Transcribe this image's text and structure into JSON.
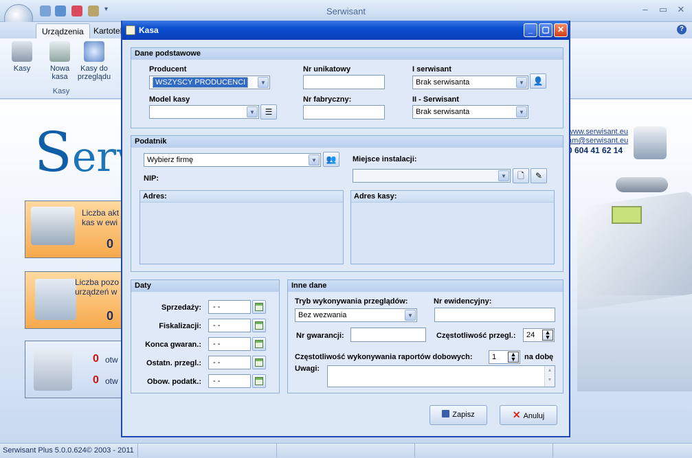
{
  "app": {
    "title": "Serwisant",
    "tabs": [
      "Urządzenia",
      "Kartotek"
    ],
    "ribbon_buttons": [
      {
        "label": "Kasy"
      },
      {
        "label": "Nowa kasa"
      },
      {
        "label": "Kasy do przeglądu"
      }
    ],
    "ribbon_group_label": "Kasy",
    "logo_text": "erw",
    "contact": {
      "website": "www.serwisant.eu",
      "email": "am@serwisant.eu",
      "phone": "0 604 41 62 14"
    },
    "cards": [
      {
        "text": "Liczba akt kas w ewi",
        "value": "0"
      },
      {
        "text": "Liczba pozo urządzeń w",
        "value": "0"
      },
      {
        "rows": [
          {
            "value": "0",
            "text": "otw"
          },
          {
            "value": "0",
            "text": "otw"
          }
        ]
      }
    ],
    "statusbar": "Serwisant Plus 5.0.0.624© 2003 - 2011"
  },
  "dialog": {
    "title": "Kasa",
    "dane_podstawowe": {
      "header": "Dane podstawowe",
      "producent_label": "Producent",
      "producent_value": "WSZYSCY PRODUCENCI",
      "nr_unikatowy_label": "Nr unikatowy",
      "nr_unikatowy_value": "",
      "serwisant1_label": "I serwisant",
      "serwisant1_value": "Brak serwisanta",
      "model_label": "Model kasy",
      "model_value": "",
      "nr_fabryczny_label": "Nr fabryczny:",
      "nr_fabryczny_value": "",
      "serwisant2_label": "II - Serwisant",
      "serwisant2_value": "Brak serwisanta"
    },
    "podatnik": {
      "header": "Podatnik",
      "firma_value": "Wybierz firmę",
      "nip_label": "NIP:",
      "miejsce_label": "Miejsce instalacji:",
      "miejsce_value": "",
      "adres_label": "Adres:",
      "adres_kasy_label": "Adres kasy:"
    },
    "daty": {
      "header": "Daty",
      "rows": [
        {
          "label": "Sprzedaży:",
          "value": "- -"
        },
        {
          "label": "Fiskalizacji:",
          "value": "- -"
        },
        {
          "label": "Konca gwaran.:",
          "value": "- -"
        },
        {
          "label": "Ostatn. przegl.:",
          "value": "- -"
        },
        {
          "label": "Obow. podatk.:",
          "value": "- -"
        }
      ]
    },
    "inne_dane": {
      "header": "Inne dane",
      "tryb_label": "Tryb wykonywania przeglądów:",
      "tryb_value": "Bez wezwania",
      "nr_ewid_label": "Nr ewidencyjny:",
      "nr_ewid_value": "",
      "nr_gwar_label": "Nr gwarancji:",
      "nr_gwar_value": "",
      "czest_label": "Częstotliwość przegl.:",
      "czest_value": "24",
      "raporty_label": "Częstotliwość wykonywania raportów dobowych:",
      "raporty_value": "1",
      "raporty_suffix": "na dobę",
      "uwagi_label": "Uwagi:",
      "uwagi_value": ""
    },
    "save_label": "Zapisz",
    "cancel_label": "Anuluj"
  }
}
